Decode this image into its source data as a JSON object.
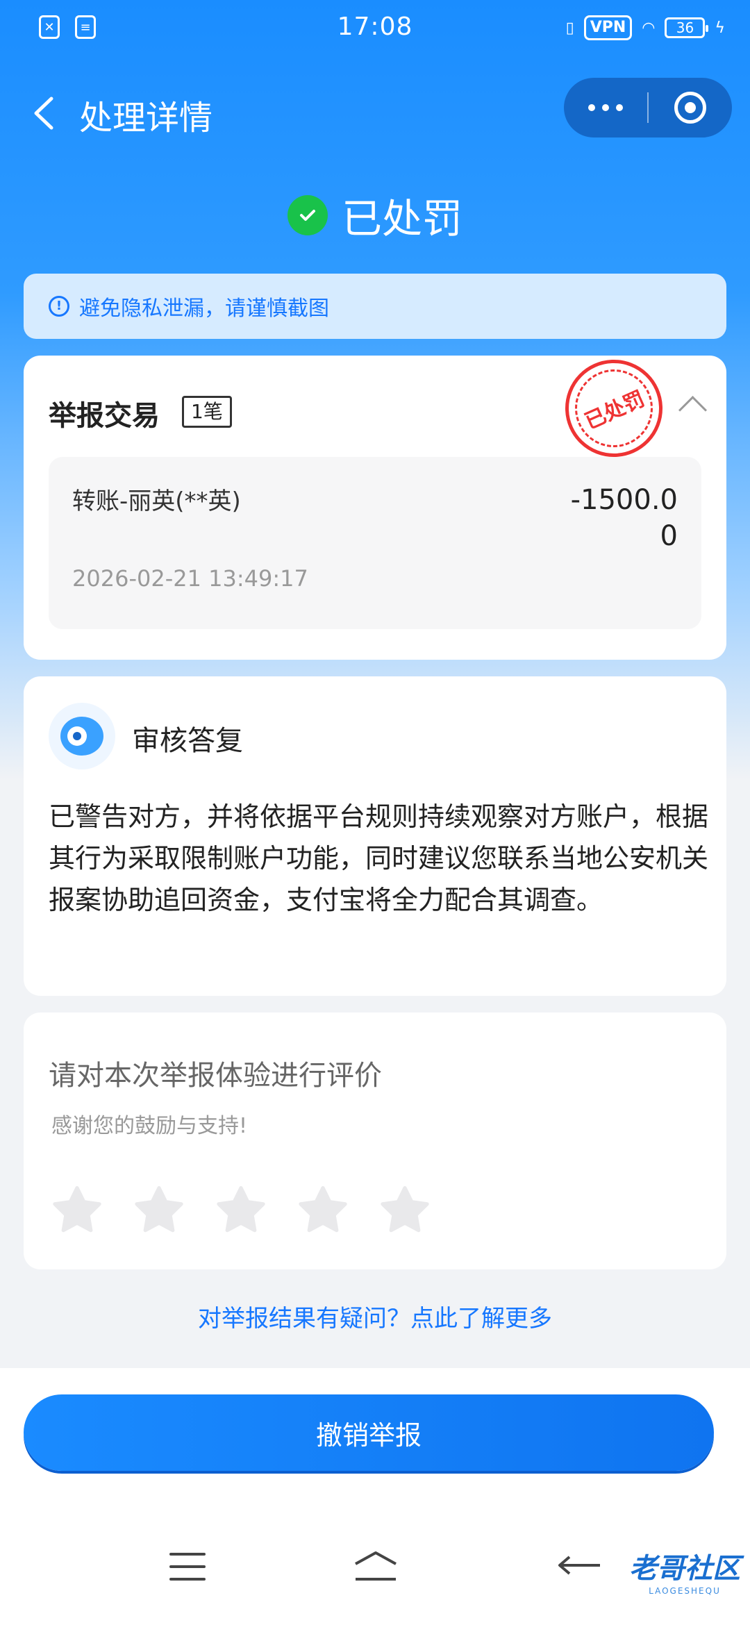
{
  "status_bar": {
    "time": "17:08",
    "vpn": "VPN",
    "battery": "36"
  },
  "nav": {
    "title": "处理详情"
  },
  "result": {
    "status": "已处罚",
    "status_color": "#19c24a"
  },
  "notice": {
    "text": "避免隐私泄漏，请谨慎截图"
  },
  "report": {
    "title": "举报交易",
    "count": "1笔",
    "stamp": "已处罚",
    "transaction": {
      "name": "转账-丽英(**英)",
      "amount": "-1500.00",
      "time": "2026-02-21 13:49:17"
    }
  },
  "review": {
    "title": "审核答复",
    "content": "已警告对方，并将依据平台规则持续观察对方账户，根据其行为采取限制账户功能，同时建议您联系当地公安机关报案协助追回资金，支付宝将全力配合其调查。"
  },
  "rating": {
    "title": "请对本次举报体验进行评价",
    "subtitle": "感谢您的鼓励与支持!",
    "stars": 0,
    "max_stars": 5
  },
  "question_link": "对举报结果有疑问？点此了解更多",
  "footer": {
    "revoke_label": "撤销举报"
  },
  "watermark": {
    "text": "老哥社区",
    "sub": "LAOGESHEQU"
  },
  "colors": {
    "accent": "#1677ff",
    "stamp": "#e33333"
  }
}
